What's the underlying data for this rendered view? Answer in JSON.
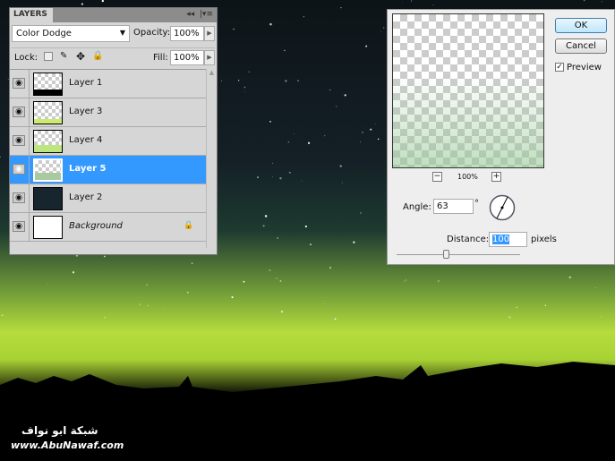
{
  "layers_panel": {
    "tab_label": "LAYERS",
    "blend_mode": "Color Dodge",
    "opacity_label": "Opacity:",
    "opacity_value": "100%",
    "lock_label": "Lock:",
    "fill_label": "Fill:",
    "fill_value": "100%",
    "layers": [
      {
        "name": "Layer 1",
        "selected": false
      },
      {
        "name": "Layer 3",
        "selected": false
      },
      {
        "name": "Layer 4",
        "selected": false
      },
      {
        "name": "Layer 5",
        "selected": true
      },
      {
        "name": "Layer 2",
        "selected": false
      },
      {
        "name": "Background",
        "selected": false,
        "locked": true
      }
    ]
  },
  "motion_blur_dialog": {
    "ok_label": "OK",
    "cancel_label": "Cancel",
    "preview_label": "Preview",
    "preview_checked": true,
    "zoom_value": "100%",
    "angle_label": "Angle:",
    "angle_value": "63",
    "degree_symbol": "°",
    "distance_label": "Distance:",
    "distance_value": "100",
    "distance_unit": "pixels"
  },
  "watermark": {
    "arabic": "شبكة ابو نواف",
    "url": "www.AbuNawaf.com"
  },
  "colors": {
    "selected_layer": "#3399ff",
    "aurora": "#b5dc3c"
  }
}
